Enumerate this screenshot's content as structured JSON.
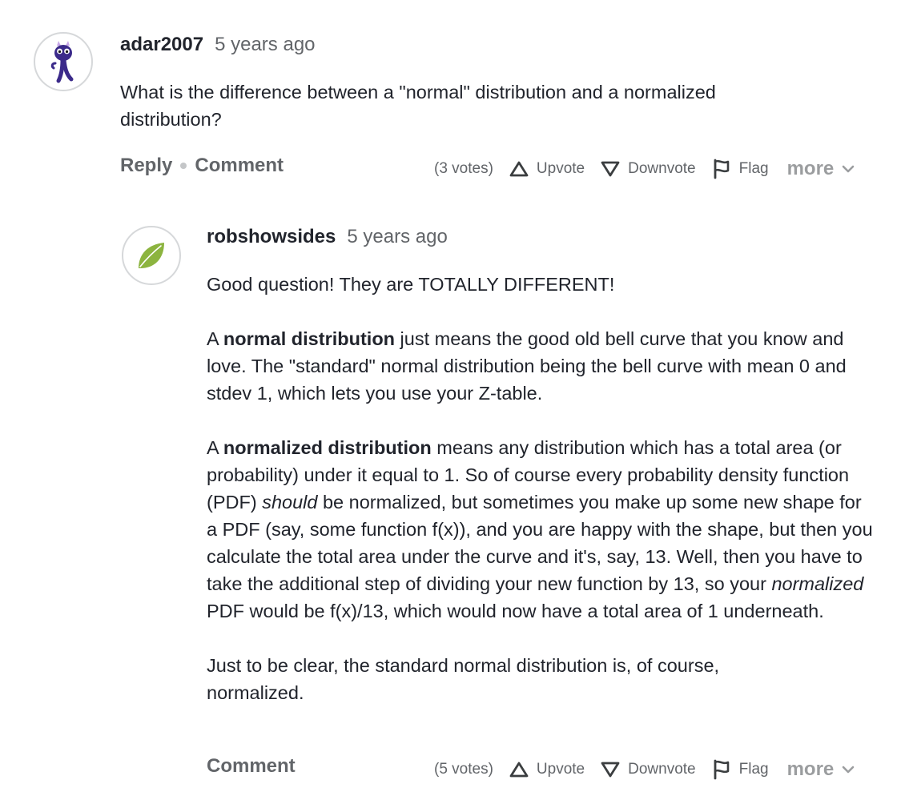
{
  "question": {
    "avatar_icon": "purple-monster-icon",
    "username": "adar2007",
    "timestamp": "5 years ago",
    "text": "What is the difference between a \"normal\" distribution and a normalized distribution?",
    "actions": {
      "reply_label": "Reply",
      "comment_label": "Comment",
      "votes": "(3 votes)",
      "upvote_label": "Upvote",
      "downvote_label": "Downvote",
      "flag_label": "Flag",
      "more_label": "more"
    }
  },
  "answer": {
    "avatar_icon": "green-leaf-icon",
    "username": "robshowsides",
    "timestamp": "5 years ago",
    "p1": "Good question! They are TOTALLY DIFFERENT!",
    "p2_bold": "normal distribution",
    "p2_pre": "A ",
    "p2_rest": " just means the good old bell curve that you know and love. The \"standard\" normal distribution being the bell curve with mean 0 and stdev 1, which lets you use your Z-table.",
    "p3_pre": "A ",
    "p3_bold": "normalized distribution",
    "p3_a": " means any distribution which has a total area (or probability) under it equal to 1. So of course every probability density function (PDF) ",
    "p3_italic1": "should",
    "p3_b": " be normalized, but sometimes you make up some new shape for a PDF (say, some function f(x)), and you are happy with the shape, but then you calculate the total area under the curve and it's, say, 13. Well, then you have to take the additional step of dividing your new function by 13, so your ",
    "p3_italic2": "normalized",
    "p3_c": " PDF would be f(x)/13, which would now have a total area of 1 underneath.",
    "p4": "Just to be clear, the standard normal distribution is, of course, normalized.",
    "actions": {
      "comment_label": "Comment",
      "votes": "(5 votes)",
      "upvote_label": "Upvote",
      "downvote_label": "Downvote",
      "flag_label": "Flag",
      "more_label": "more"
    }
  },
  "colors": {
    "text": "#21242c",
    "muted": "#626569",
    "more": "#9b9d9f",
    "avatar_purple": "#3b2a8a",
    "leaf_green": "#8cb43f"
  }
}
